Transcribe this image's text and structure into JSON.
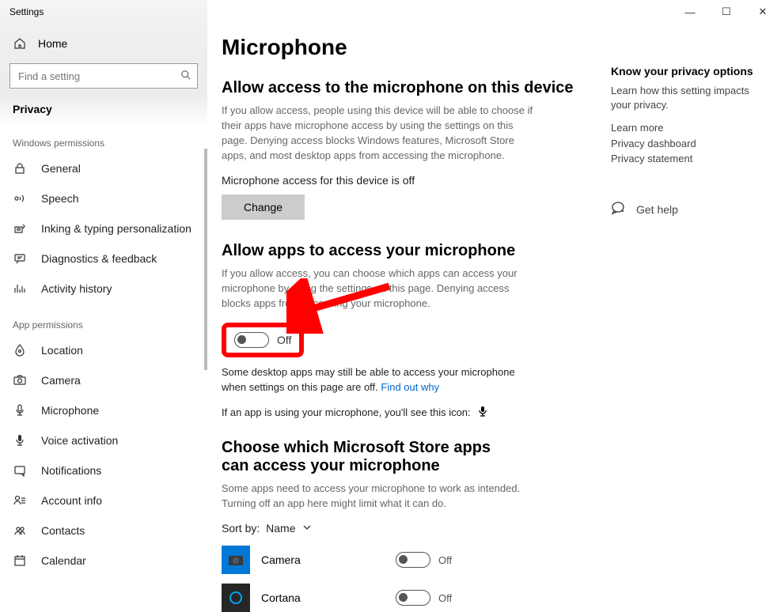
{
  "window": {
    "title": "Settings",
    "min": "—",
    "max": "☐",
    "close": "✕"
  },
  "sidebar": {
    "home": "Home",
    "search_placeholder": "Find a setting",
    "privacy": "Privacy",
    "win_perms": "Windows permissions",
    "app_perms": "App permissions",
    "win_items": [
      {
        "label": "General"
      },
      {
        "label": "Speech"
      },
      {
        "label": "Inking & typing personalization"
      },
      {
        "label": "Diagnostics & feedback"
      },
      {
        "label": "Activity history"
      }
    ],
    "app_items": [
      {
        "label": "Location"
      },
      {
        "label": "Camera"
      },
      {
        "label": "Microphone"
      },
      {
        "label": "Voice activation"
      },
      {
        "label": "Notifications"
      },
      {
        "label": "Account info"
      },
      {
        "label": "Contacts"
      },
      {
        "label": "Calendar"
      }
    ]
  },
  "main": {
    "title": "Microphone",
    "s1_h": "Allow access to the microphone on this device",
    "s1_p": "If you allow access, people using this device will be able to choose if their apps have microphone access by using the settings on this page. Denying access blocks Windows features, Microsoft Store apps, and most desktop apps from accessing the microphone.",
    "s1_status": "Microphone access for this device is off",
    "change_btn": "Change",
    "s2_h": "Allow apps to access your microphone",
    "s2_p": "If you allow access, you can choose which apps can access your microphone by using the settings on this page. Denying access blocks apps from accessing your microphone.",
    "s2_toggle": "Off",
    "s2_note_a": "Some desktop apps may still be able to access your microphone when settings on this page are off. ",
    "s2_note_link": "Find out why",
    "s2_icon_line": "If an app is using your microphone, you'll see this icon:",
    "s3_h": "Choose which Microsoft Store apps can access your microphone",
    "s3_p": "Some apps need to access your microphone to work as intended. Turning off an app here might limit what it can do.",
    "sort_label": "Sort by:",
    "sort_value": "Name",
    "apps": [
      {
        "name": "Camera",
        "state": "Off"
      },
      {
        "name": "Cortana",
        "state": "Off"
      }
    ]
  },
  "right": {
    "h": "Know your privacy options",
    "p": "Learn how this setting impacts your privacy.",
    "links": [
      "Learn more",
      "Privacy dashboard",
      "Privacy statement"
    ],
    "help": "Get help"
  }
}
